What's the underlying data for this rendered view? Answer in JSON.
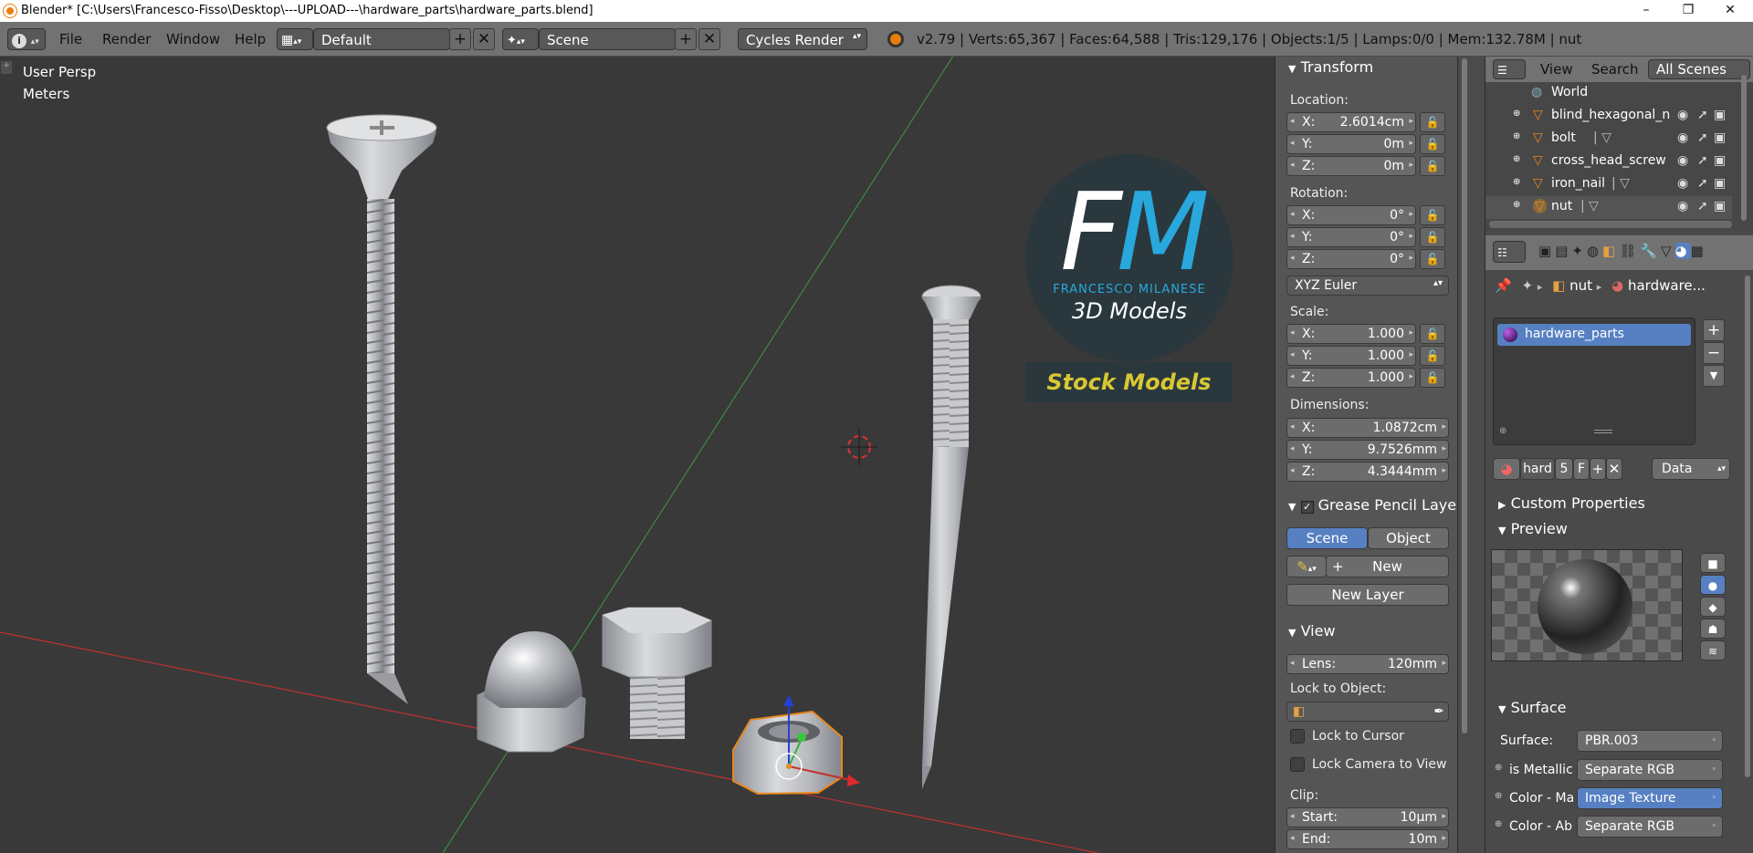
{
  "window": {
    "title": "Blender* [C:\\Users\\Francesco-Fisso\\Desktop\\---UPLOAD---\\hardware_parts\\hardware_parts.blend]",
    "minimize": "–",
    "maximize": "❐",
    "close": "✕"
  },
  "infobar": {
    "menus": [
      "File",
      "Render",
      "Window",
      "Help"
    ],
    "layout": "Default",
    "scene": "Scene",
    "engine": "Cycles Render",
    "stats": "v2.79 | Verts:65,367 | Faces:64,588 | Tris:129,176 | Objects:1/5 | Lamps:0/0 | Mem:132.78M | nut"
  },
  "viewport": {
    "view_name": "User Persp",
    "units": "Meters",
    "logo": {
      "letters_f": "F",
      "letters_m": "M",
      "name": "FRANCESCO MILANESE",
      "sub": "3D Models",
      "stock": "Stock Models"
    }
  },
  "transform": {
    "header": "Transform",
    "location_label": "Location:",
    "location": [
      {
        "k": "X:",
        "v": "2.6014cm"
      },
      {
        "k": "Y:",
        "v": "0m"
      },
      {
        "k": "Z:",
        "v": "0m"
      }
    ],
    "rotation_label": "Rotation:",
    "rotation": [
      {
        "k": "X:",
        "v": "0°"
      },
      {
        "k": "Y:",
        "v": "0°"
      },
      {
        "k": "Z:",
        "v": "0°"
      }
    ],
    "rotation_mode": "XYZ Euler",
    "scale_label": "Scale:",
    "scale": [
      {
        "k": "X:",
        "v": "1.000"
      },
      {
        "k": "Y:",
        "v": "1.000"
      },
      {
        "k": "Z:",
        "v": "1.000"
      }
    ],
    "dimensions_label": "Dimensions:",
    "dimensions": [
      {
        "k": "X:",
        "v": "1.0872cm"
      },
      {
        "k": "Y:",
        "v": "9.7526mm"
      },
      {
        "k": "Z:",
        "v": "4.3444mm"
      }
    ]
  },
  "grease_pencil": {
    "header": "Grease Pencil Layer",
    "tab_scene": "Scene",
    "tab_object": "Object",
    "new": "New",
    "new_layer": "New Layer"
  },
  "view_panel": {
    "header": "View",
    "lens_label": "Lens:",
    "lens_value": "120mm",
    "lock_object_label": "Lock to Object:",
    "lock_cursor": "Lock to Cursor",
    "lock_camera": "Lock Camera to View",
    "clip_label": "Clip:",
    "clip_start_label": "Start:",
    "clip_start": "10µm",
    "clip_end_label": "End:",
    "clip_end": "10m"
  },
  "outliner": {
    "view": "View",
    "search": "Search",
    "filter": "All Scenes",
    "items": [
      "World",
      "blind_hexagonal_nut",
      "bolt",
      "cross_head_screw",
      "iron_nail",
      "nut"
    ]
  },
  "material": {
    "breadcrumb_obj": "nut",
    "breadcrumb_mat": "hardware...",
    "slot": "hardware_parts",
    "mat_name": "hard",
    "users": "5",
    "fake": "F",
    "link": "Data",
    "custom_props": "Custom Properties",
    "preview": "Preview",
    "surface": "Surface",
    "surface_label": "Surface:",
    "surface_value": "PBR.003",
    "inputs": [
      {
        "label": "is Metallic",
        "value": "Separate RGB"
      },
      {
        "label": "Color - Ma",
        "value": "Image Texture"
      },
      {
        "label": "Color - Ab",
        "value": "Separate RGB"
      }
    ]
  },
  "colors": {
    "accent": "#5680c2",
    "logo_blue": "#28a8dd",
    "logo_yellow": "#d9c832",
    "selection_orange": "#e8871e"
  }
}
